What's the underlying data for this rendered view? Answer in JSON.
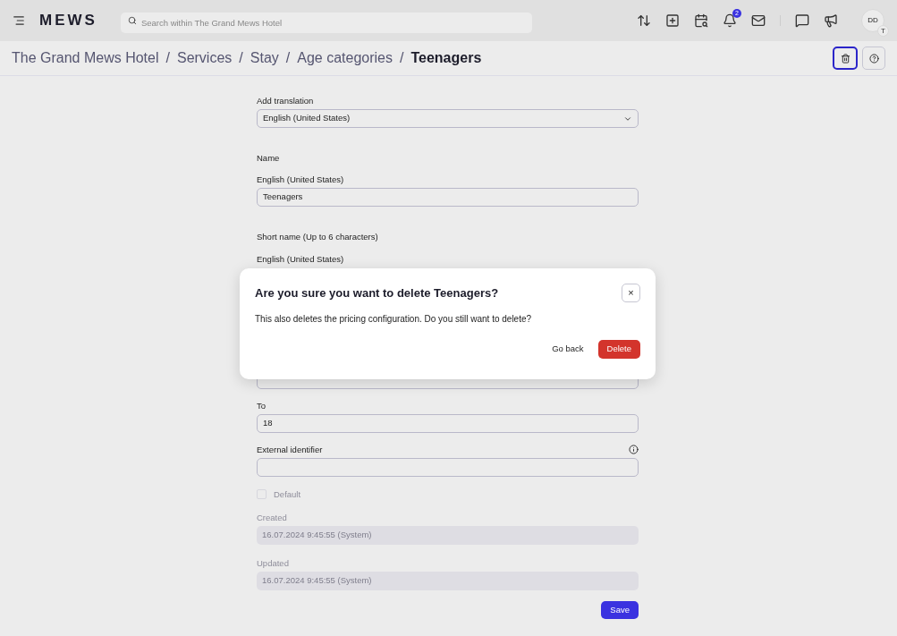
{
  "header": {
    "logo": "MEWS",
    "search": {
      "placeholder": "Search within The Grand Mews Hotel"
    },
    "notification_count": "2",
    "avatar": {
      "initials": "DD",
      "badge": "T"
    }
  },
  "breadcrumb_separator": "/",
  "breadcrumbs": [
    {
      "label": "The Grand Mews Hotel",
      "current": false
    },
    {
      "label": "Services",
      "current": false
    },
    {
      "label": "Stay",
      "current": false
    },
    {
      "label": "Age categories",
      "current": false
    },
    {
      "label": "Teenagers",
      "current": true
    }
  ],
  "form": {
    "fields": [
      {
        "kind": "select",
        "label": "Add translation",
        "value": "English (United States)"
      },
      {
        "kind": "heading",
        "label": "Name"
      },
      {
        "kind": "input",
        "label": "English (United States)",
        "value": "Teenagers"
      },
      {
        "kind": "heading",
        "label": "Short name (Up to 6 characters)"
      },
      {
        "kind": "label",
        "label": "English (United States)"
      },
      {
        "kind": "covered-input"
      },
      {
        "kind": "input",
        "label": "To",
        "value": "18"
      },
      {
        "kind": "input",
        "label": "External identifier",
        "info": true
      },
      {
        "kind": "checkbox",
        "label": "Default",
        "checked": false,
        "disabled": true
      },
      {
        "kind": "readonly",
        "label": "Created",
        "value": "16.07.2024 9:45:55 (System)"
      },
      {
        "kind": "readonly",
        "label": "Updated",
        "value": "16.07.2024 9:45:55 (System)"
      }
    ],
    "submit": "Save"
  },
  "dialog": {
    "title": "Are you sure you want to delete Teenagers?",
    "message": "This also deletes the pricing configuration. Do you still want to delete?",
    "close": "×",
    "buttons": [
      {
        "label": "Go back",
        "kind": "secondary"
      },
      {
        "label": "Delete",
        "kind": "danger"
      }
    ]
  }
}
